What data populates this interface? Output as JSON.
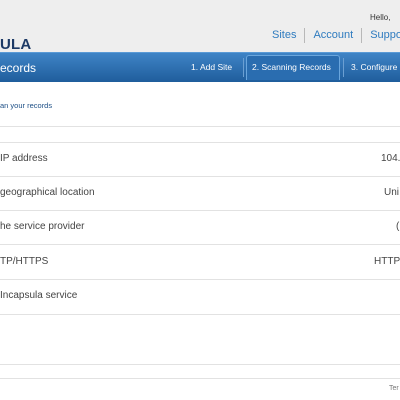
{
  "header": {
    "logo_text": "ULA",
    "greeting": "Hello,",
    "nav": [
      {
        "label": "Sites"
      },
      {
        "label": "Account"
      },
      {
        "label": "Suppo"
      }
    ]
  },
  "titlebar": {
    "title": "ecords",
    "steps": [
      {
        "label": "1. Add Site"
      },
      {
        "label": "2. Scanning Records"
      },
      {
        "label": "3. Configure"
      }
    ]
  },
  "main": {
    "subtitle": "an your records",
    "rows": [
      {
        "label": "IP address",
        "value": "104."
      },
      {
        "label": "geographical location",
        "value": "Uni"
      },
      {
        "label": "he service provider",
        "value": "("
      },
      {
        "label": "TP/HTTPS",
        "value": "HTTP"
      },
      {
        "label": "Incapsula service",
        "value": ""
      }
    ]
  },
  "footer": {
    "text": "Ter"
  },
  "colors": {
    "brand_blue": "#1f5d9c",
    "link_blue": "#2e7bbf",
    "logo_navy": "#1d3a66"
  }
}
